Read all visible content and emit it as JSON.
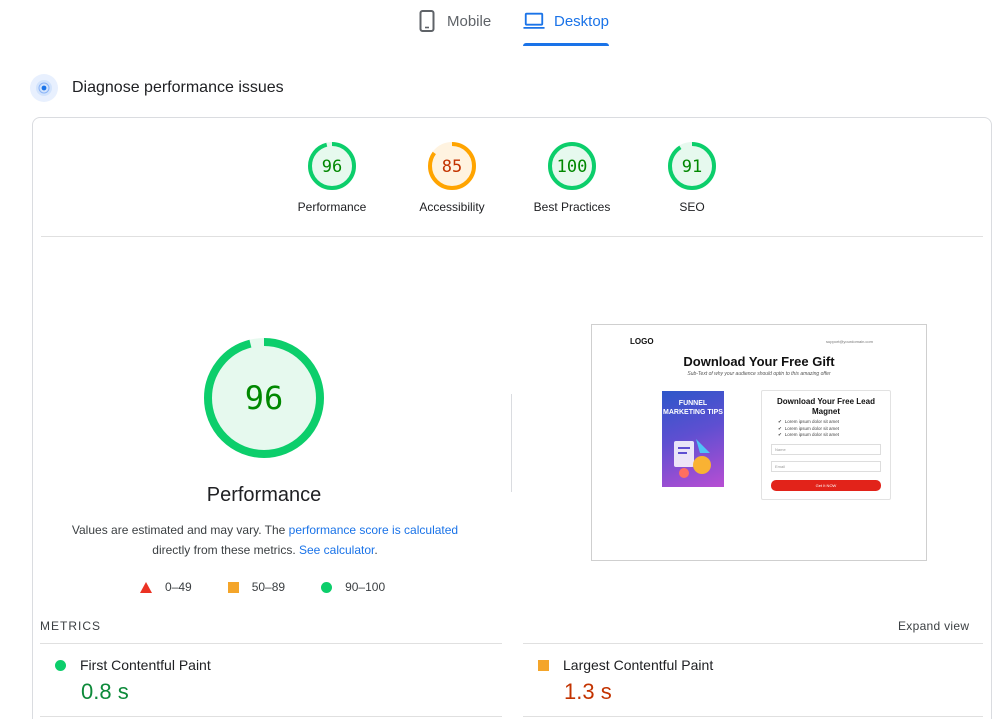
{
  "tabs": {
    "mobile": {
      "label": "Mobile",
      "icon": "phone-icon"
    },
    "desktop": {
      "label": "Desktop",
      "icon": "laptop-icon",
      "selected": true
    }
  },
  "diagnose": {
    "title": "Diagnose performance issues",
    "icon": "gauge-icon"
  },
  "scores": [
    {
      "label": "Performance",
      "value": "96",
      "status": "good",
      "fraction": 0.96
    },
    {
      "label": "Accessibility",
      "value": "85",
      "status": "average",
      "fraction": 0.85
    },
    {
      "label": "Best Practices",
      "value": "100",
      "status": "good",
      "fraction": 1.0
    },
    {
      "label": "SEO",
      "value": "91",
      "status": "good",
      "fraction": 0.91
    }
  ],
  "main_score": {
    "value": "96",
    "fraction": 0.96,
    "title": "Performance",
    "desc_1": "Values are estimated and may vary. The ",
    "desc_link_1": "performance score is calculated",
    "desc_2": "directly from these metrics. ",
    "desc_link_2": "See calculator",
    "desc_3": "."
  },
  "legend": [
    {
      "range": "0–49",
      "shape": "triangle",
      "color": "#eb3223"
    },
    {
      "range": "50–89",
      "shape": "square",
      "color": "#f4a52a"
    },
    {
      "range": "90–100",
      "shape": "circle",
      "color": "#0cce6b"
    }
  ],
  "screenshot": {
    "logo": "LOGO",
    "email": "support@yourdomain.com",
    "headline": "Download Your Free Gift",
    "subtext": "Sub-Text of why your audience should optin to this amazing offer",
    "book_title": "FUNNEL MARKETING TIPS",
    "form_title": "Download Your Free Lead Magnet",
    "bullets": [
      "Lorem ipsum dolor sit amet",
      "Lorem ipsum dolor sit amet",
      "Lorem ipsum dolor sit amet"
    ],
    "name_placeholder": "Name",
    "email_placeholder": "Email",
    "button": "Get It NOW"
  },
  "metrics": {
    "label": "METRICS",
    "expand": "Expand view",
    "items": [
      {
        "name": "First Contentful Paint",
        "value": "0.8 s",
        "status": "good"
      },
      {
        "name": "Largest Contentful Paint",
        "value": "1.3 s",
        "status": "average"
      }
    ]
  },
  "colors": {
    "accent": "#1a73e8",
    "good": "#0cce6b",
    "good_text": "#008800",
    "average": "#ffa400",
    "average_text": "#c33300",
    "good_bg": "#e6f9ee",
    "average_bg": "#fff3e0"
  }
}
